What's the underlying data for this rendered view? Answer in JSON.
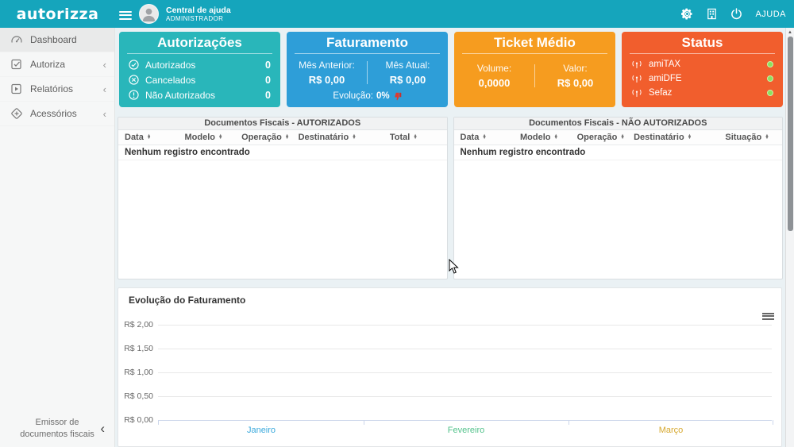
{
  "header": {
    "logo": "autorizza",
    "help_center": "Central de ajuda",
    "user_role": "ADMINISTRADOR",
    "ajuda_label": "AJUDA"
  },
  "sidebar": {
    "items": [
      {
        "label": "Dashboard",
        "active": true
      },
      {
        "label": "Autoriza",
        "active": false
      },
      {
        "label": "Relatórios",
        "active": false
      },
      {
        "label": "Acessórios",
        "active": false
      }
    ],
    "footer_line1": "Emissor de",
    "footer_line2": "documentos fiscais"
  },
  "icons": {
    "chevron_left": "‹",
    "sort_up": "▲",
    "sort_down": "▼",
    "scroll_up": "▲"
  },
  "cards": {
    "autorizacoes": {
      "title": "Autorizações",
      "color": "#29b6ba",
      "rows": [
        {
          "label": "Autorizados",
          "value": "0"
        },
        {
          "label": "Cancelados",
          "value": "0"
        },
        {
          "label": "Não Autorizados",
          "value": "0"
        }
      ]
    },
    "faturamento": {
      "title": "Faturamento",
      "color": "#2e9ed8",
      "prev_label": "Mês Anterior:",
      "prev_value": "R$ 0,00",
      "curr_label": "Mês Atual:",
      "curr_value": "R$ 0,00",
      "evolution_label": "Evolução:",
      "evolution_value": "0%"
    },
    "ticket_medio": {
      "title": "Ticket Médio",
      "color": "#f69c1f",
      "volume_label": "Volume:",
      "volume_value": "0,0000",
      "valor_label": "Valor:",
      "valor_value": "R$ 0,00"
    },
    "status": {
      "title": "Status",
      "color": "#f15e2d",
      "services": [
        {
          "name": "amiTAX",
          "status_color": "#8ce05e"
        },
        {
          "name": "amiDFE",
          "status_color": "#8ce05e"
        },
        {
          "name": "Sefaz",
          "status_color": "#8ce05e"
        }
      ]
    }
  },
  "tables": {
    "authorized": {
      "title": "Documentos Fiscais - AUTORIZADOS",
      "columns": [
        "Data",
        "Modelo",
        "Operação",
        "Destinatário",
        "Total"
      ],
      "empty_message": "Nenhum registro encontrado"
    },
    "not_authorized": {
      "title": "Documentos Fiscais - NÃO AUTORIZADOS",
      "columns": [
        "Data",
        "Modelo",
        "Operação",
        "Destinatário",
        "Situação"
      ],
      "empty_message": "Nenhum registro encontrado"
    }
  },
  "chart_data": {
    "type": "line",
    "title": "Evolução do Faturamento",
    "categories": [
      "Janeiro",
      "Fevereiro",
      "Março"
    ],
    "category_colors": [
      "#3aa9dc",
      "#53c28b",
      "#d6a82e"
    ],
    "series": [],
    "y_ticks": [
      "R$ 2,00",
      "R$ 1,50",
      "R$ 1,00",
      "R$ 0,50",
      "R$ 0,00"
    ],
    "ylim": [
      0,
      2
    ],
    "xlabel": "",
    "ylabel": "",
    "grid": true,
    "legend": "none"
  }
}
